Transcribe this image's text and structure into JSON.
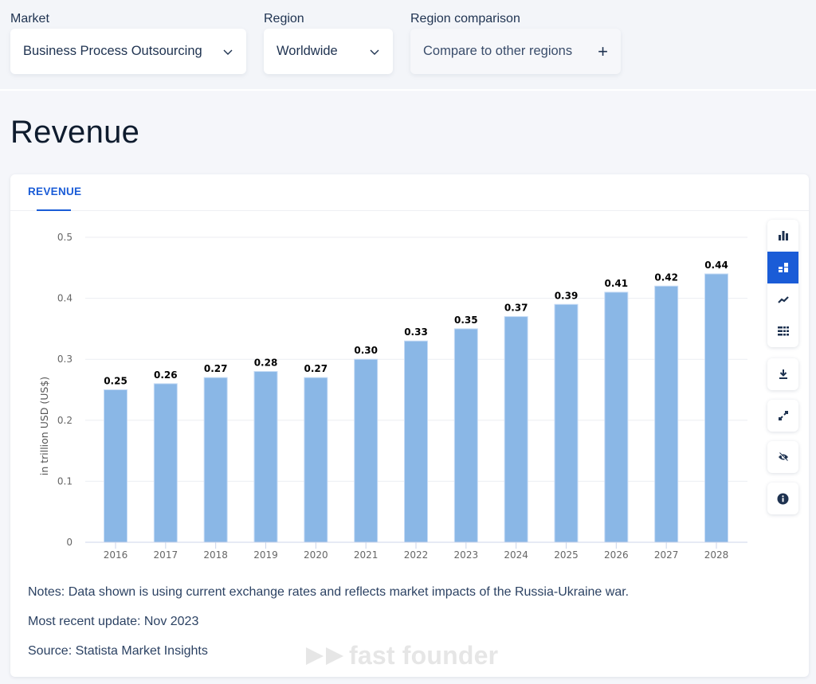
{
  "filters": {
    "market": {
      "label": "Market",
      "value": "Business Process Outsourcing",
      "icon": "chevron-down-icon"
    },
    "region": {
      "label": "Region",
      "value": "Worldwide",
      "icon": "chevron-down-icon"
    },
    "comparison": {
      "label": "Region comparison",
      "value": "Compare to other regions",
      "icon": "plus-icon",
      "icon_glyph": "+"
    }
  },
  "page_title": "Revenue",
  "card": {
    "tabs": [
      {
        "label": "REVENUE",
        "active": true
      }
    ],
    "toolbar": {
      "view_group": [
        {
          "name": "bar-chart-icon",
          "active": false
        },
        {
          "name": "stacked-bar-icon",
          "active": true
        },
        {
          "name": "trend-line-icon",
          "active": false
        },
        {
          "name": "table-icon",
          "active": false
        }
      ],
      "actions": [
        "download-icon",
        "fullscreen-icon",
        "hide-icon",
        "info-icon"
      ]
    },
    "notes": [
      "Notes: Data shown is using current exchange rates and reflects market impacts of the Russia-Ukraine war.",
      "Most recent update: Nov 2023",
      "Source: Statista Market Insights"
    ],
    "watermark": "fast founder"
  },
  "colors": {
    "accent": "#1a5cd7",
    "bar": "#8ab7e6",
    "text": "#1e3250",
    "gridline": "#eceef2"
  },
  "chart_data": {
    "type": "bar",
    "title": "Revenue",
    "xlabel": "",
    "ylabel": "in trillion USD (US$)",
    "categories": [
      "2016",
      "2017",
      "2018",
      "2019",
      "2020",
      "2021",
      "2022",
      "2023",
      "2024",
      "2025",
      "2026",
      "2027",
      "2028"
    ],
    "values": [
      0.25,
      0.26,
      0.27,
      0.28,
      0.27,
      0.3,
      0.33,
      0.35,
      0.37,
      0.39,
      0.41,
      0.42,
      0.44
    ],
    "data_labels": [
      "0.25",
      "0.26",
      "0.27",
      "0.28",
      "0.27",
      "0.30",
      "0.33",
      "0.35",
      "0.37",
      "0.39",
      "0.41",
      "0.42",
      "0.44"
    ],
    "ylim": [
      0,
      0.5
    ],
    "yticks": [
      0,
      0.1,
      0.2,
      0.3,
      0.4,
      0.5
    ],
    "ytick_labels": [
      "0",
      "0.1",
      "0.2",
      "0.3",
      "0.4",
      "0.5"
    ],
    "grid": true,
    "legend": "none"
  }
}
